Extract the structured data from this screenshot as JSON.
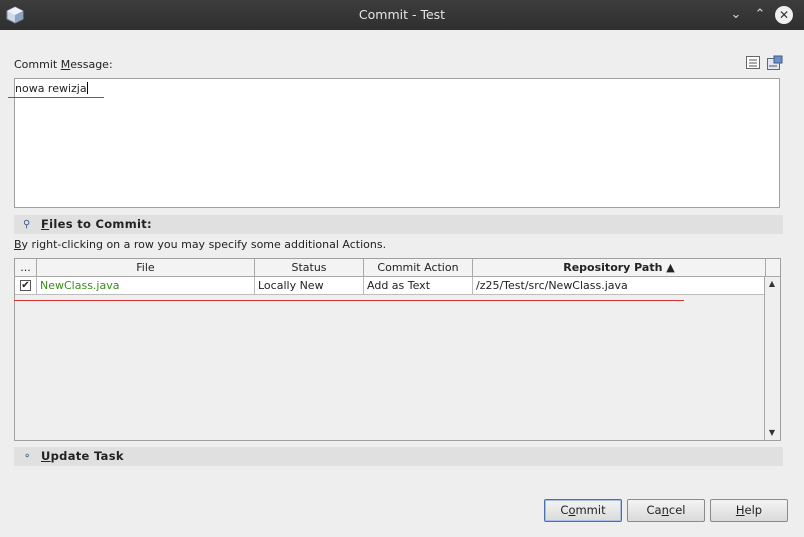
{
  "window": {
    "title": "Commit - Test"
  },
  "commit_message": {
    "label_pre": "Commit ",
    "label_mnemonic": "M",
    "label_post": "essage:",
    "value": "nowa rewizja"
  },
  "files_section": {
    "mnemonic": "F",
    "title_rest": "iles to Commit:",
    "hint_mnemonic": "B",
    "hint_rest": "y right-clicking on a row you may specify some additional Actions."
  },
  "table": {
    "columns": [
      "...",
      "File",
      "Status",
      "Commit Action",
      "Repository Path ▲"
    ],
    "rows": [
      {
        "checked": true,
        "file": "NewClass.java",
        "status": "Locally New",
        "action": "Add as Text",
        "path": "/z25/Test/src/NewClass.java"
      }
    ]
  },
  "update_section": {
    "mnemonic": "U",
    "title_rest": "pdate Task"
  },
  "buttons": {
    "commit_pre": "C",
    "commit_mn": "o",
    "commit_post": "mmit",
    "cancel_pre": "Ca",
    "cancel_mn": "n",
    "cancel_post": "cel",
    "help_mn": "H",
    "help_post": "elp"
  },
  "colors": {
    "new_file": "#3c8a1e",
    "annotation": "#d63030"
  }
}
